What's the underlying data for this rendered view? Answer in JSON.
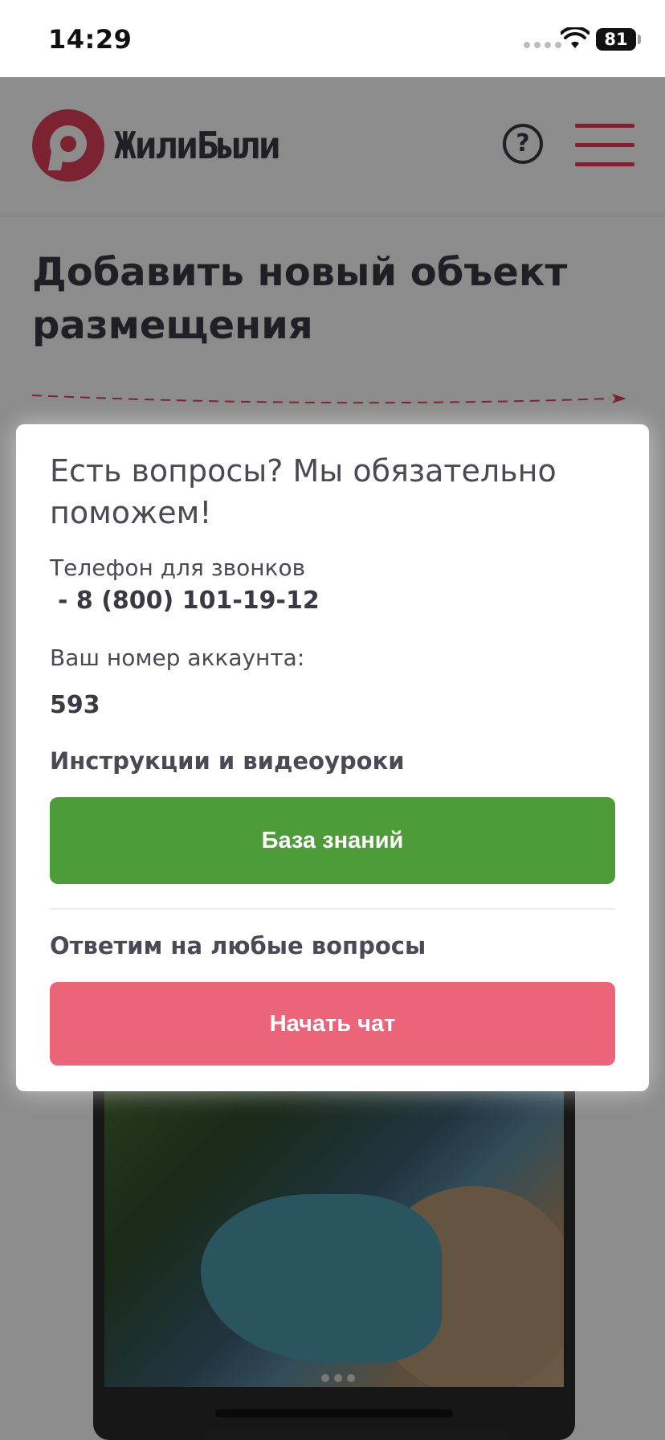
{
  "status_bar": {
    "time": "14:29",
    "battery": "81"
  },
  "header": {
    "logo_text": "ЖилиБыли",
    "help_symbol": "?"
  },
  "page": {
    "title": "Добавить новый объект размещения"
  },
  "modal": {
    "heading": "Есть вопросы? Мы обязательно поможем!",
    "phone_label": "Телефон для звонков",
    "phone_number": "- 8 (800) 101-19-12",
    "account_label": "Ваш номер аккаунта:",
    "account_number": "593",
    "instructions_label": "Инструкции и видеоуроки",
    "knowledge_base_button": "База знаний",
    "questions_label": "Ответим на любые вопросы",
    "chat_button": "Начать чат"
  },
  "colors": {
    "brand_red": "#e0405a",
    "green": "#4e9c39",
    "pink": "#ec6478"
  },
  "icons": [
    "wifi-icon",
    "battery-icon",
    "logo-icon",
    "help-icon",
    "menu-icon",
    "airplane-icon"
  ]
}
